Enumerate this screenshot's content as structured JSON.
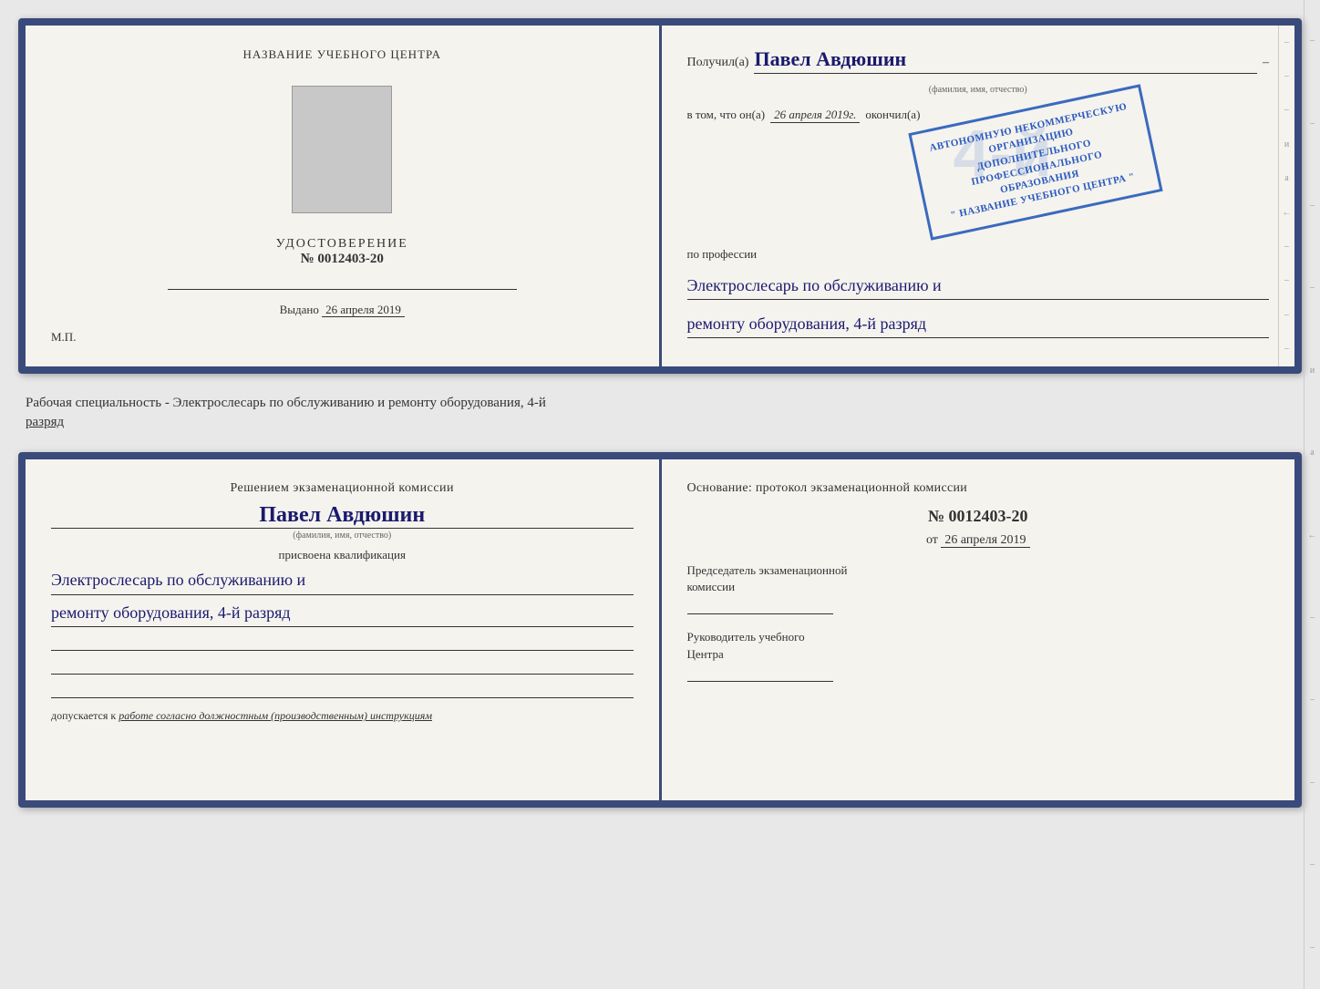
{
  "top_left": {
    "title": "НАЗВАНИЕ УЧЕБНОГО ЦЕНТРА",
    "udostoverenie_label": "УДОСТОВЕРЕНИЕ",
    "number": "№ 0012403-20",
    "vydano_label": "Выдано",
    "vydano_date": "26 апреля 2019",
    "mp_label": "М.П."
  },
  "top_right": {
    "poluchil_label": "Получил(а)",
    "recipient_name": "Павел Авдюшин",
    "fio_caption": "(фамилия, имя, отчество)",
    "vtom_label": "в том, что он(а)",
    "vtom_date": "26 апреля 2019г.",
    "okonchil_label": "окончил(а)",
    "stamp_line1": "АВТОНОМНУЮ НЕКОММЕРЧЕСКУЮ ОРГАНИЗАЦИЮ",
    "stamp_line2": "ДОПОЛНИТЕЛЬНОГО ПРОФЕССИОНАЛЬНОГО ОБРАЗОВАНИЯ",
    "stamp_line3": "\" НАЗВАНИЕ УЧЕБНОГО ЦЕНТРА \"",
    "po_professii_label": "по профессии",
    "profession_line1": "Электрослесарь по обслуживанию и",
    "profession_line2": "ремонту оборудования, 4-й разряд"
  },
  "between_text": "Рабочая специальность - Электрослесарь по обслуживанию и ремонту оборудования, 4-й\nразряд",
  "bottom_left": {
    "resheniem_title": "Решением экзаменационной комиссии",
    "name": "Павел Авдюшин",
    "fio_caption": "(фамилия, имя, отчество)",
    "prisvoena_label": "присвоена квалификация",
    "qualification_line1": "Электрослесарь по обслуживанию и",
    "qualification_line2": "ремонту оборудования, 4-й разряд",
    "dopuskaetsya_label": "допускается к",
    "dopuskaetsya_text": "работе согласно должностным (производственным) инструкциям"
  },
  "bottom_right": {
    "osnovanie_label": "Основание: протокол экзаменационной комиссии",
    "protokol_num": "№ 0012403-20",
    "protokol_date_prefix": "от",
    "protokol_date": "26 апреля 2019",
    "predsedatel_label": "Председатель экзаменационной\nкомиссии",
    "rukovoditel_label": "Руководитель учебного\nЦентра"
  },
  "right_dashes": [
    "–",
    "–",
    "–",
    "и",
    "а",
    "←",
    "–",
    "–",
    "–",
    "–"
  ],
  "right_dashes_bottom": [
    "–",
    "–",
    "–",
    "–",
    "и",
    "а",
    "←",
    "–",
    "–",
    "–",
    "–",
    "–"
  ]
}
